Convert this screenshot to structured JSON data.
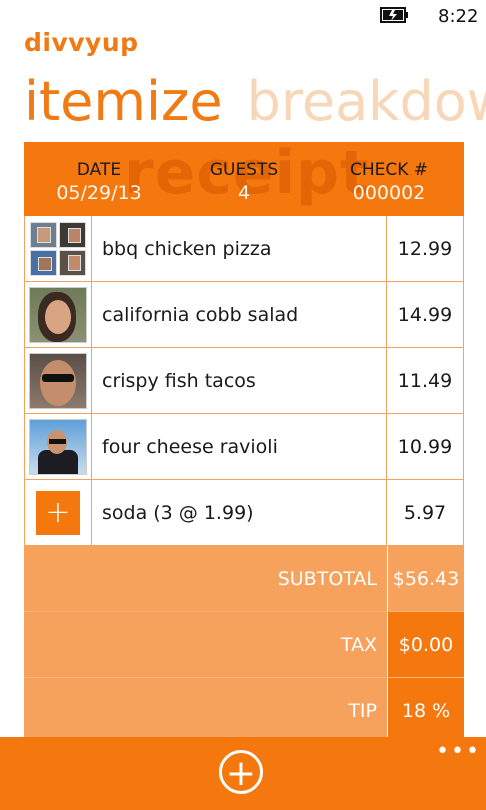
{
  "status_bar": {
    "time": "8:22",
    "battery_icon": "battery-charging-icon"
  },
  "app": {
    "title": "divvyup"
  },
  "pivot": {
    "items": [
      "itemize",
      "breakdown"
    ],
    "active_index": 0
  },
  "receipt": {
    "watermark": "receipt",
    "date_label": "DATE",
    "date": "05/29/13",
    "guests_label": "GUESTS",
    "guests": "4",
    "check_label": "CHECK #",
    "check": "000002",
    "items": [
      {
        "name": "bbq chicken pizza",
        "price": "12.99",
        "thumb": "group-photos"
      },
      {
        "name": "california cobb salad",
        "price": "14.99",
        "thumb": "woman-photo"
      },
      {
        "name": "crispy fish tacos",
        "price": "11.49",
        "thumb": "man-sunglasses-photo"
      },
      {
        "name": "four cheese ravioli",
        "price": "10.99",
        "thumb": "man-suit-photo"
      },
      {
        "name": "soda (3 @ 1.99)",
        "price": "5.97",
        "thumb": "add-icon",
        "add_symbol": "+"
      }
    ],
    "subtotal_label": "SUBTOTAL",
    "subtotal": "$56.43",
    "tax_label": "TAX",
    "tax": "$0.00",
    "tip_label": "TIP",
    "tip": "18 %"
  },
  "app_bar": {
    "add_symbol": "+",
    "more_symbol": "•••"
  },
  "colors": {
    "accent": "#f5780f",
    "accent_light": "#f7a25c",
    "pivot_inactive": "#f8d7b8"
  }
}
